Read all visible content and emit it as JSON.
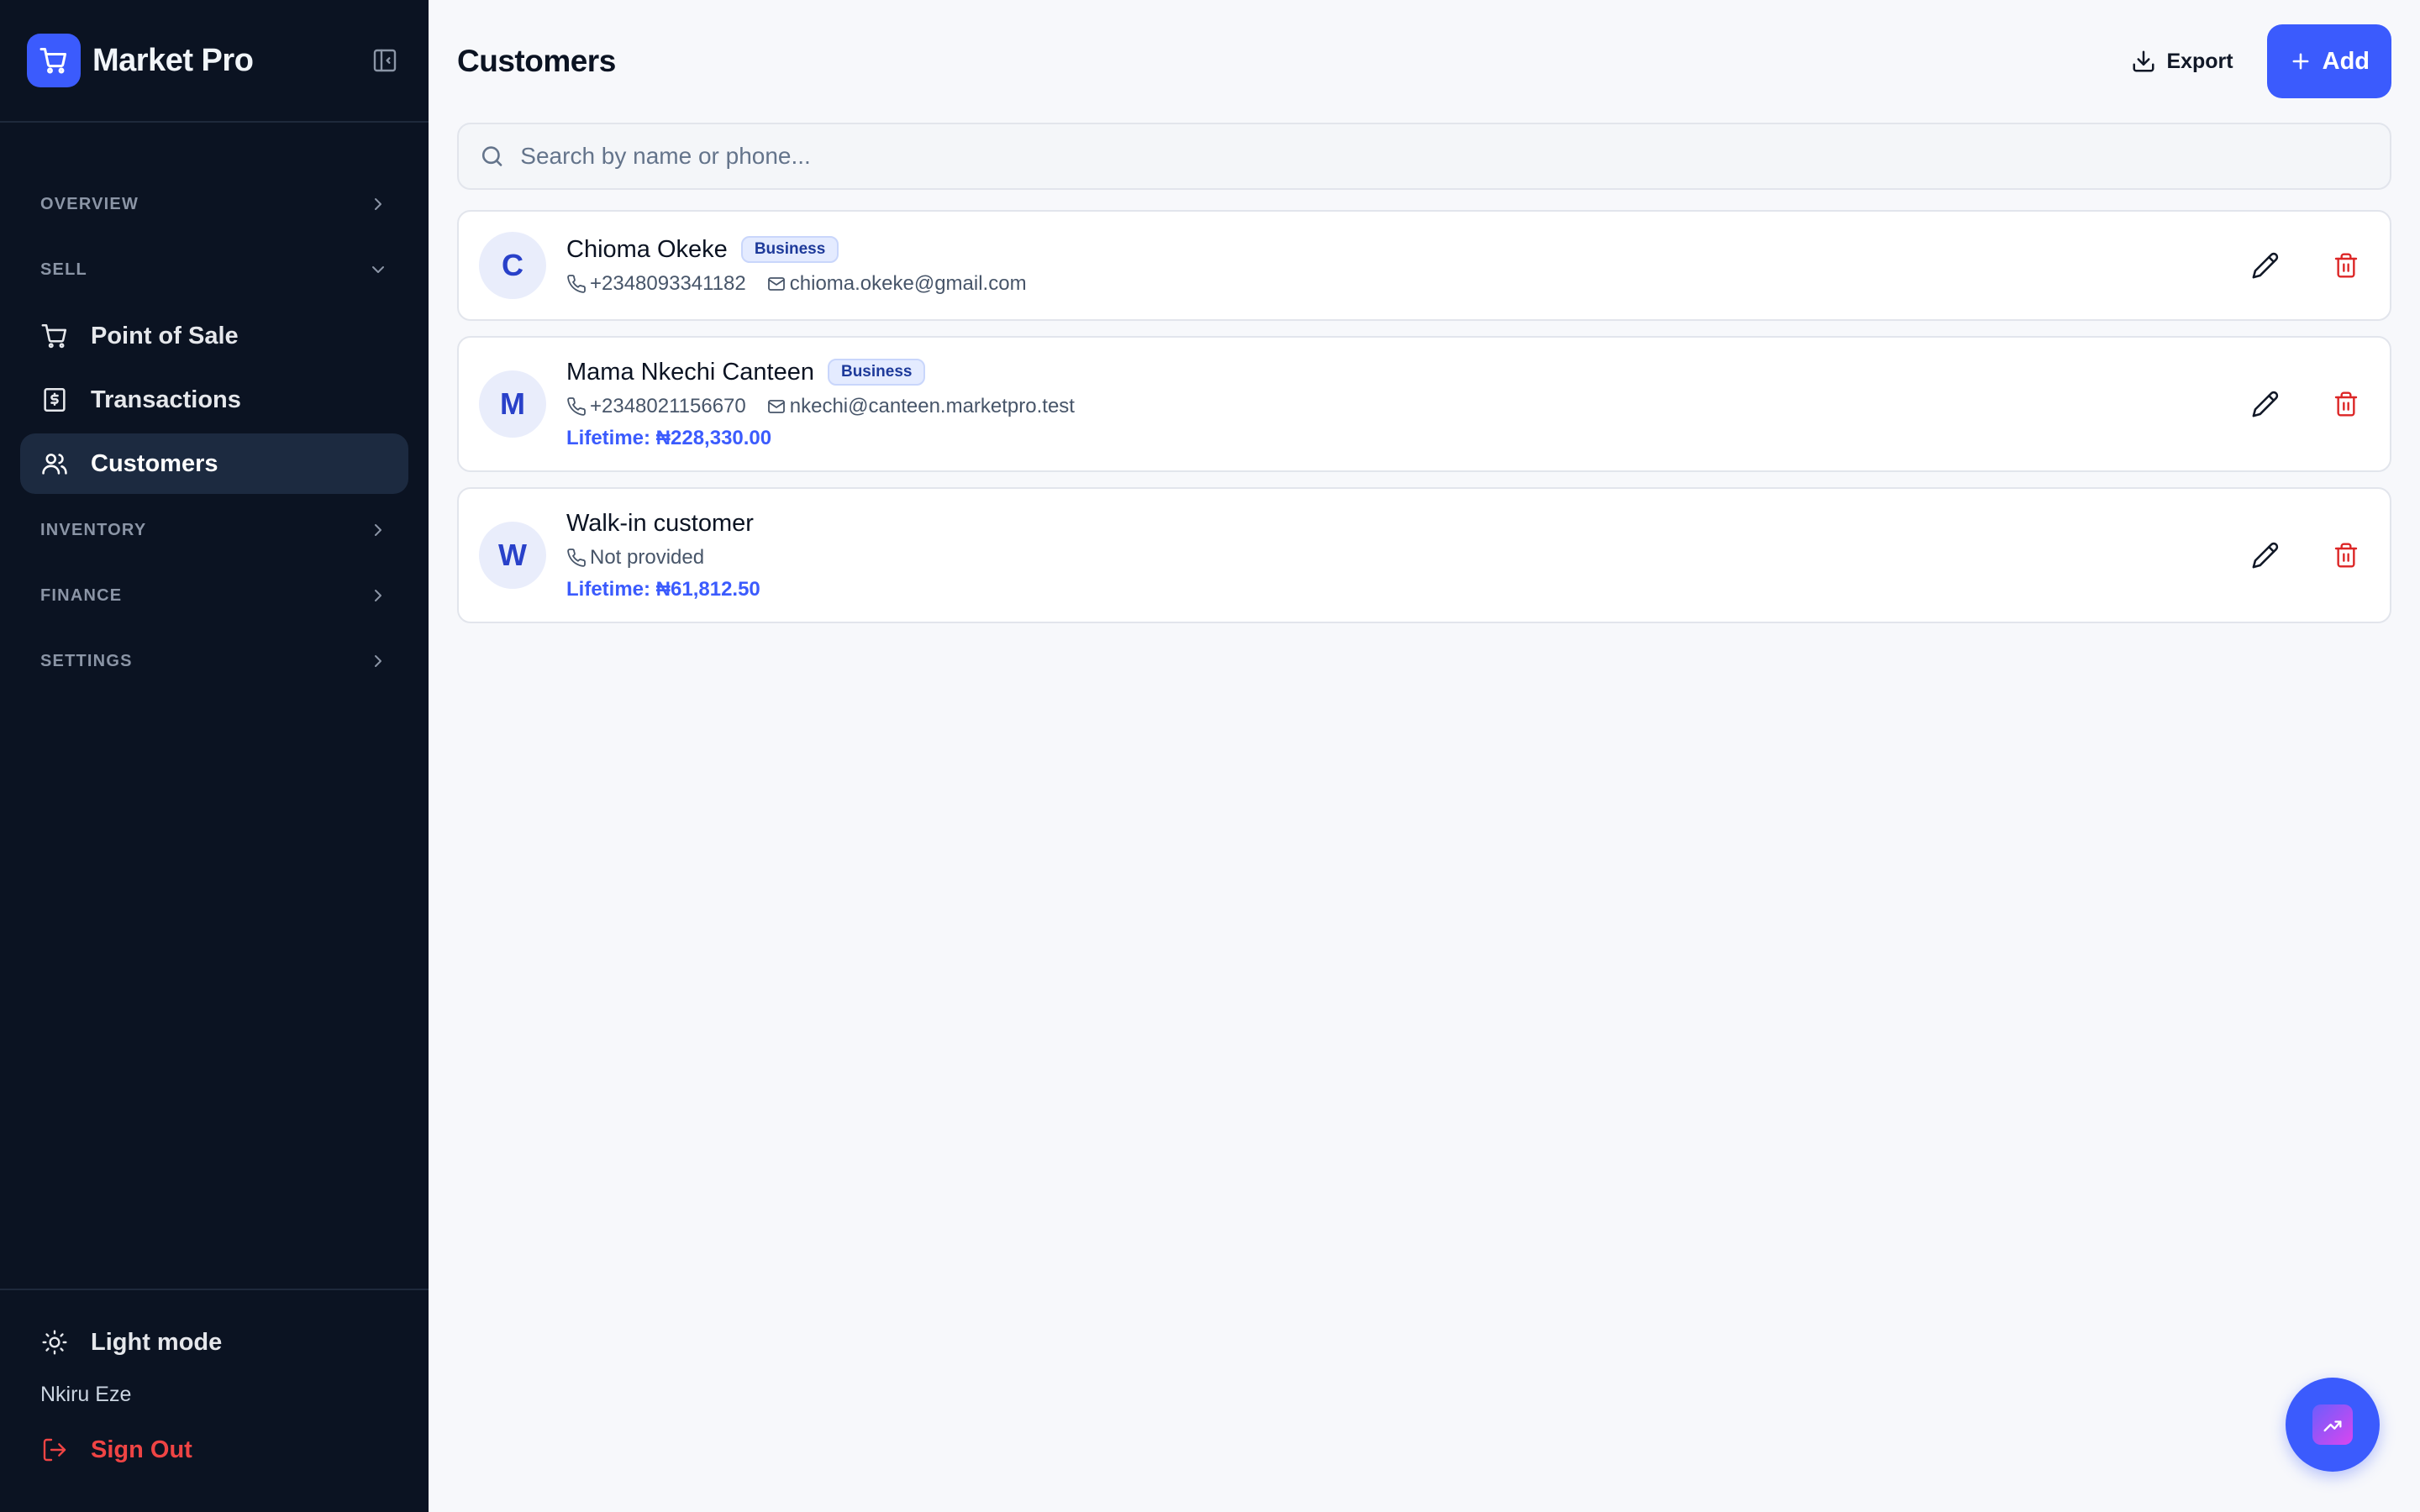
{
  "app": {
    "name": "Market Pro"
  },
  "sidebar": {
    "sections": {
      "overview": "OVERVIEW",
      "sell": "SELL",
      "inventory": "INVENTORY",
      "finance": "FINANCE",
      "settings": "SETTINGS"
    },
    "sell_items": [
      {
        "label": "Point of Sale",
        "icon": "cart-icon"
      },
      {
        "label": "Transactions",
        "icon": "receipt-icon"
      },
      {
        "label": "Customers",
        "icon": "users-icon",
        "active": true
      }
    ],
    "bottom": {
      "theme_toggle": "Light mode",
      "user_name": "Nkiru Eze",
      "sign_out": "Sign Out"
    }
  },
  "header": {
    "title": "Customers",
    "export_label": "Export",
    "add_label": "Add"
  },
  "search": {
    "placeholder": "Search by name or phone..."
  },
  "customers": [
    {
      "initial": "C",
      "name": "Chioma Okeke",
      "badge": "Business",
      "phone": "+2348093341182",
      "email": "chioma.okeke@gmail.com",
      "lifetime": ""
    },
    {
      "initial": "M",
      "name": "Mama Nkechi Canteen",
      "badge": "Business",
      "phone": "+2348021156670",
      "email": "nkechi@canteen.marketpro.test",
      "lifetime": "Lifetime: ₦228,330.00"
    },
    {
      "initial": "W",
      "name": "Walk-in customer",
      "badge": "",
      "phone": "Not provided",
      "email": "",
      "lifetime": "Lifetime: ₦61,812.50"
    }
  ],
  "colors": {
    "sidebar_bg": "#0b1322",
    "accent": "#3b5bfd",
    "danger": "#ef4444"
  }
}
